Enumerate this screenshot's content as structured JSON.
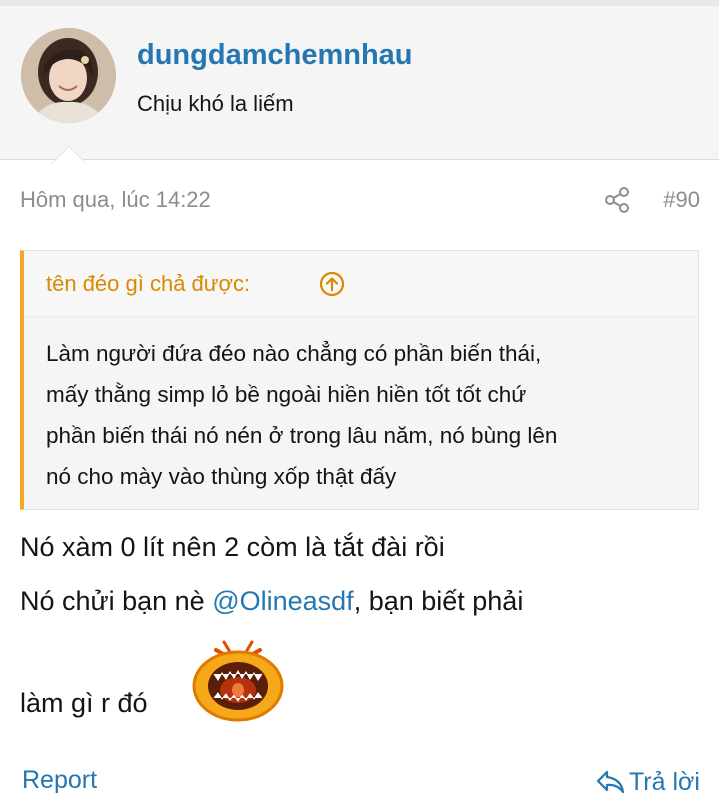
{
  "user": {
    "username": "dungdamchemnhau",
    "title": "Chịu khó la liếm"
  },
  "post": {
    "timestamp": "Hôm qua, lúc 14:22",
    "number": "#90"
  },
  "quote": {
    "author": "tên đéo gì chả được:",
    "lines": [
      "Làm người đứa đéo nào chẳng có phần biến thái,",
      "mấy thằng simp lỏ bề ngoài hiền hiền tốt tốt chứ",
      "phần biến thái nó nén ở trong lâu năm, nó bùng lên",
      "nó cho mày vào thùng xốp thật đấy"
    ]
  },
  "message": {
    "line1": "Nó xàm 0 lít nên 2 còm là tắt đài rồi",
    "line2_prefix": "Nó chửi bạn nè ",
    "mention": "@Olineasdf",
    "line2_suffix": ", bạn biết phải",
    "line3": "làm gì r đó"
  },
  "footer": {
    "report_label": "Report",
    "reply_label": "Trả lời"
  },
  "colors": {
    "link": "#2577b1",
    "quote_accent": "#f5a623",
    "meta": "#8c8c8c"
  },
  "icons": {
    "share": "share-icon",
    "quote_expand": "circle-arrow-up-icon",
    "reply": "reply-arrow-icon",
    "emoji": "shouting-emoji"
  }
}
